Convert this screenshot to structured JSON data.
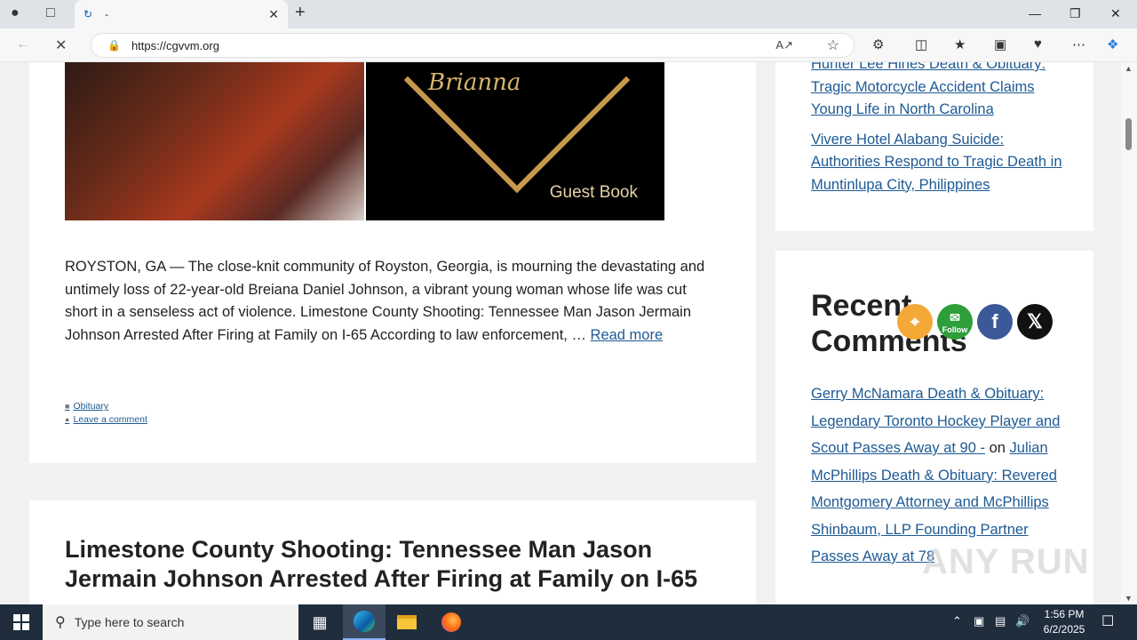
{
  "browser": {
    "tab_title": "-",
    "url": "https://cgvvm.org"
  },
  "hero": {
    "script_text": "Brianna",
    "guest_book": "Guest Book"
  },
  "post1": {
    "excerpt": "ROYSTON, GA — The close-knit community of Royston, Georgia, is mourning the devastating and untimely loss of 22-year-old Breiana Daniel Johnson, a vibrant young woman whose life was cut short in a senseless act of violence. Limestone County Shooting: Tennessee Man Jason Jermain Johnson Arrested After Firing at Family on I-65 According to law enforcement, … ",
    "read_more": "Read more",
    "category": "Obituary",
    "comment_link": "Leave a comment"
  },
  "post2": {
    "title": "Limestone County Shooting: Tennessee Man Jason Jermain Johnson Arrested After Firing at Family on I-65"
  },
  "sidebar": {
    "links": [
      "Hunter Lee Hines Death & Obituary: Tragic Motorcycle Accident Claims Young Life in North Carolina",
      "Vivere Hotel Alabang Suicide: Authorities Respond to Tragic Death in Muntinlupa City, Philippines"
    ],
    "recent_comments_heading": "Recent Comments",
    "comment_link_1": "Gerry McNamara Death & Obituary: Legendary Toronto Hockey Player and Scout Passes Away at 90 -",
    "comment_on": " on ",
    "comment_link_2": "Julian McPhillips Death & Obituary: Revered Montgomery Attorney and McPhillips Shinbaum, LLP Founding Partner Passes Away at 78"
  },
  "social": {
    "follow_label": "Follow"
  },
  "watermark": "ANY RUN",
  "taskbar": {
    "search_placeholder": "Type here to search",
    "time": "1:56 PM",
    "date": "6/2/2025"
  },
  "icons": [
    "profile-icon",
    "tab-actions-icon",
    "new-tab-icon",
    "back-icon",
    "reload-stop-icon",
    "lock-icon",
    "read-aloud-icon",
    "favorite-icon",
    "extensions-icon",
    "split-screen-icon",
    "favorites-icon",
    "collections-icon",
    "performance-icon",
    "more-icon",
    "copilot-icon"
  ],
  "colors": {
    "link": "#1e5a94",
    "rss": "#f4a836",
    "follow": "#2d9e3a",
    "facebook": "#3b5998",
    "x": "#111111"
  }
}
